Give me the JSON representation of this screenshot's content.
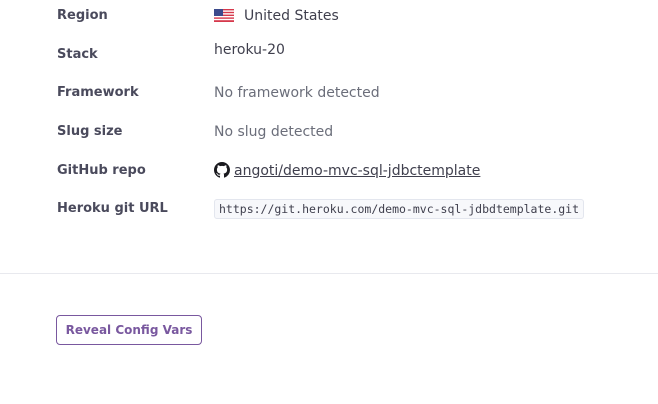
{
  "info": {
    "region": {
      "label": "Region",
      "value": "United States",
      "icon": "us-flag-icon"
    },
    "stack": {
      "label": "Stack",
      "value": "heroku-20"
    },
    "framework": {
      "label": "Framework",
      "value": "No framework detected"
    },
    "slug_size": {
      "label": "Slug size",
      "value": "No slug detected"
    },
    "github_repo": {
      "label": "GitHub repo",
      "value": "angoti/demo-mvc-sql-jdbctemplate",
      "icon": "github-icon"
    },
    "git_url": {
      "label": "Heroku git URL",
      "value": "https://git.heroku.com/demo-mvc-sql-jdbdtemplate.git"
    }
  },
  "config_vars": {
    "button_label": "Reveal Config Vars"
  },
  "colors": {
    "accent": "#79589f",
    "label": "#4a4a5c",
    "muted": "#6b6e7a"
  }
}
